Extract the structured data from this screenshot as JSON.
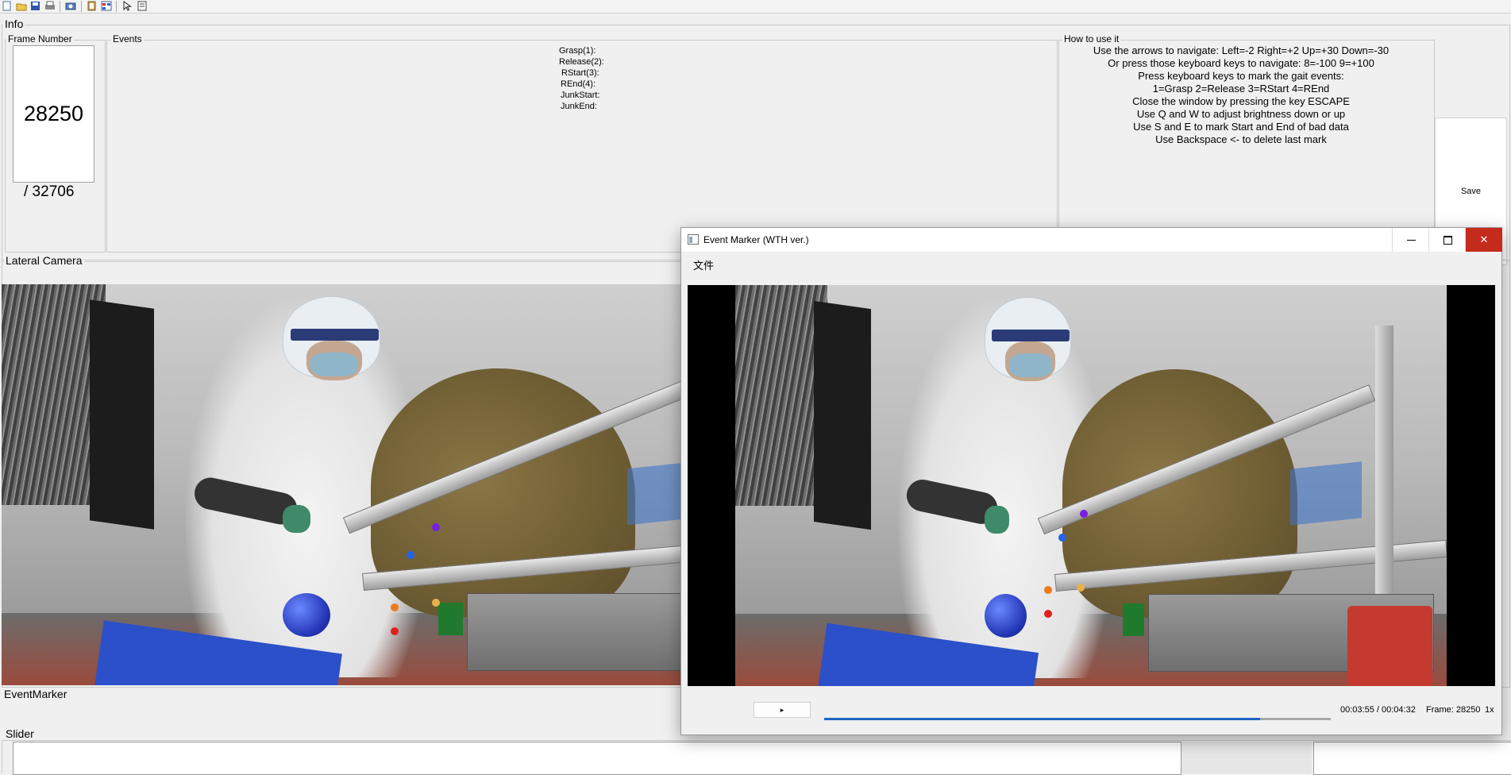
{
  "toolbar": {
    "icons": [
      "new-icon",
      "open-icon",
      "save-icon",
      "print-icon",
      "camera-icon",
      "clipboard-icon",
      "grid-icon",
      "pointer-icon",
      "document-list-icon"
    ]
  },
  "info": {
    "title": "Info",
    "frame_group_title": "Frame Number",
    "current_frame": "28250",
    "total_frames": "/ 32706",
    "events_title": "Events",
    "events": [
      "Grasp(1):",
      "Release(2):",
      "RStart(3):",
      "REnd(4):",
      "JunkStart:",
      "JunkEnd:"
    ],
    "howto_title": "How to use it",
    "howto_lines": [
      "Use the arrows to navigate: Left=-2 Right=+2 Up=+30 Down=-30",
      "Or press those keyboard keys to navigate: 8=-100 9=+100",
      "Press keyboard keys to mark the gait events:",
      "1=Grasp 2=Release 3=RStart 4=REnd",
      "Close the window by pressing the key ESCAPE",
      "Use Q and W to adjust brightness down or up",
      "Use S and E to mark Start and End of bad data",
      "Use Backspace <- to delete last mark"
    ],
    "save_label": "Save"
  },
  "lateral": {
    "title": "Lateral Camera"
  },
  "eventmarker_label": "EventMarker",
  "slider": {
    "title": "Slider"
  },
  "player_window": {
    "title": "Event Marker (WTH ver.)",
    "minimize": "🗕",
    "maximize": "☐",
    "close": "✕",
    "menu_file": "文件",
    "play_symbol": "▸",
    "progress_fraction": 0.86,
    "time": "00:03:55 / 00:04:32",
    "frame": "Frame: 28250",
    "speed": "1x"
  },
  "colors": {
    "accent": "#1d66c2",
    "close_red": "#c42b1c",
    "marker_purple": "#7a1fe0",
    "marker_blue": "#2563eb",
    "marker_orange": "#f07a1a",
    "marker_yellow": "#e8b24a",
    "marker_red": "#e0201b"
  }
}
